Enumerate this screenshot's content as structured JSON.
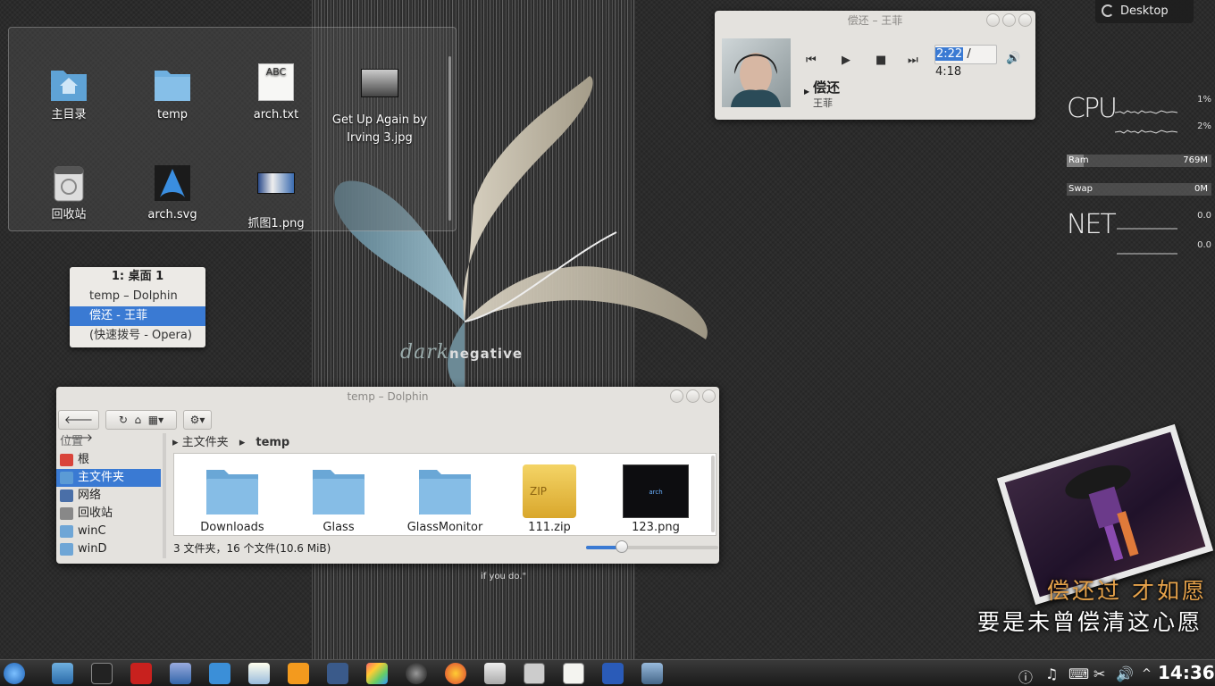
{
  "desktop": {
    "icons": [
      {
        "label": "主目录",
        "icon": "home-folder-icon"
      },
      {
        "label": "temp",
        "icon": "folder-icon"
      },
      {
        "label": "arch.txt",
        "icon": "text-file-icon",
        "thumb": "ABC"
      },
      {
        "label": "Get Up Again by Irving 3.jpg",
        "icon": "image-file-icon"
      },
      {
        "label": "回收站",
        "icon": "trash-icon"
      },
      {
        "label": "arch.svg",
        "icon": "arch-logo-icon"
      },
      {
        "label": "抓图1.png",
        "icon": "screenshot-thumbnail-icon"
      }
    ],
    "wallpaper_logo_a": "dark",
    "wallpaper_logo_b": "negative",
    "wallpaper_caption": "if you do.\""
  },
  "pager": {
    "header": "1: 桌面 1",
    "items": [
      "temp – Dolphin",
      "偿还 - 王菲",
      "(快速拨号 - Opera)"
    ],
    "selected_index": 1
  },
  "player": {
    "window_title": "偿还 – 王菲",
    "song_title": "偿还",
    "artist": "王菲",
    "current_time": "2:22",
    "separator": " / ",
    "total_time": "4:18",
    "controls": [
      "previous-icon",
      "play-icon",
      "stop-icon",
      "next-icon",
      "volume-icon"
    ]
  },
  "desktop_button": {
    "label": "Desktop"
  },
  "sysmon": {
    "cpu_label": "CPU",
    "cpu1": "1%",
    "cpu2": "2%",
    "ram_label": "Ram",
    "ram_value": "769M",
    "ram_fraction": 0.12,
    "swap_label": "Swap",
    "swap_value": "0M",
    "swap_fraction": 0,
    "net_label": "NET",
    "net_up": "0.0",
    "net_down": "0.0"
  },
  "dolphin": {
    "window_title": "temp – Dolphin",
    "toolbar": [
      "back-icon",
      "forward-icon",
      "reload-icon",
      "home-icon",
      "view-mode-icon",
      "settings-icon"
    ],
    "places_header": "位置",
    "places": [
      {
        "label": "根",
        "color": "#d9443a"
      },
      {
        "label": "主文件夹",
        "color": "#5b9bd5"
      },
      {
        "label": "网络",
        "color": "#4a6fa8"
      },
      {
        "label": "回收站",
        "color": "#888888"
      },
      {
        "label": "winC",
        "color": "#6fa6d6"
      },
      {
        "label": "winD",
        "color": "#6fa6d6"
      }
    ],
    "selected_place": 1,
    "breadcrumb_root": "主文件夹",
    "breadcrumb_current": "temp",
    "files": [
      {
        "name": "Downloads",
        "icon": "folder-icon"
      },
      {
        "name": "Glass",
        "icon": "folder-icon"
      },
      {
        "name": "GlassMonitor",
        "icon": "folder-icon"
      },
      {
        "name": "111.zip",
        "icon": "zip-archive-icon",
        "thumb": "ZIP"
      },
      {
        "name": "123.png",
        "icon": "image-thumbnail-icon",
        "thumb": "arch"
      }
    ],
    "status": "3 文件夹，16 个文件(10.6 MiB)",
    "zoom_fraction": 0.27
  },
  "lyrics": {
    "line1": "偿还过 才如愿",
    "line2": "要是未曾偿清这心愿"
  },
  "taskbar": {
    "launcher": "kde-launcher-icon",
    "apps": [
      "desktop-icon",
      "konsole-icon",
      "opera-icon",
      "navigator-icon",
      "qq-icon",
      "music-app-icon",
      "image-app-icon",
      "clapper-icon",
      "paint-icon",
      "camera-icon",
      "firefox-icon",
      "eye-icon",
      "calculator-icon",
      "text-editor-icon",
      "word-icon",
      "tools-icon"
    ],
    "tray": [
      "info-icon",
      "music-note-icon",
      "keyboard-icon",
      "scissors-icon",
      "volume-icon",
      "expand-icon"
    ],
    "clock": "14:36"
  }
}
